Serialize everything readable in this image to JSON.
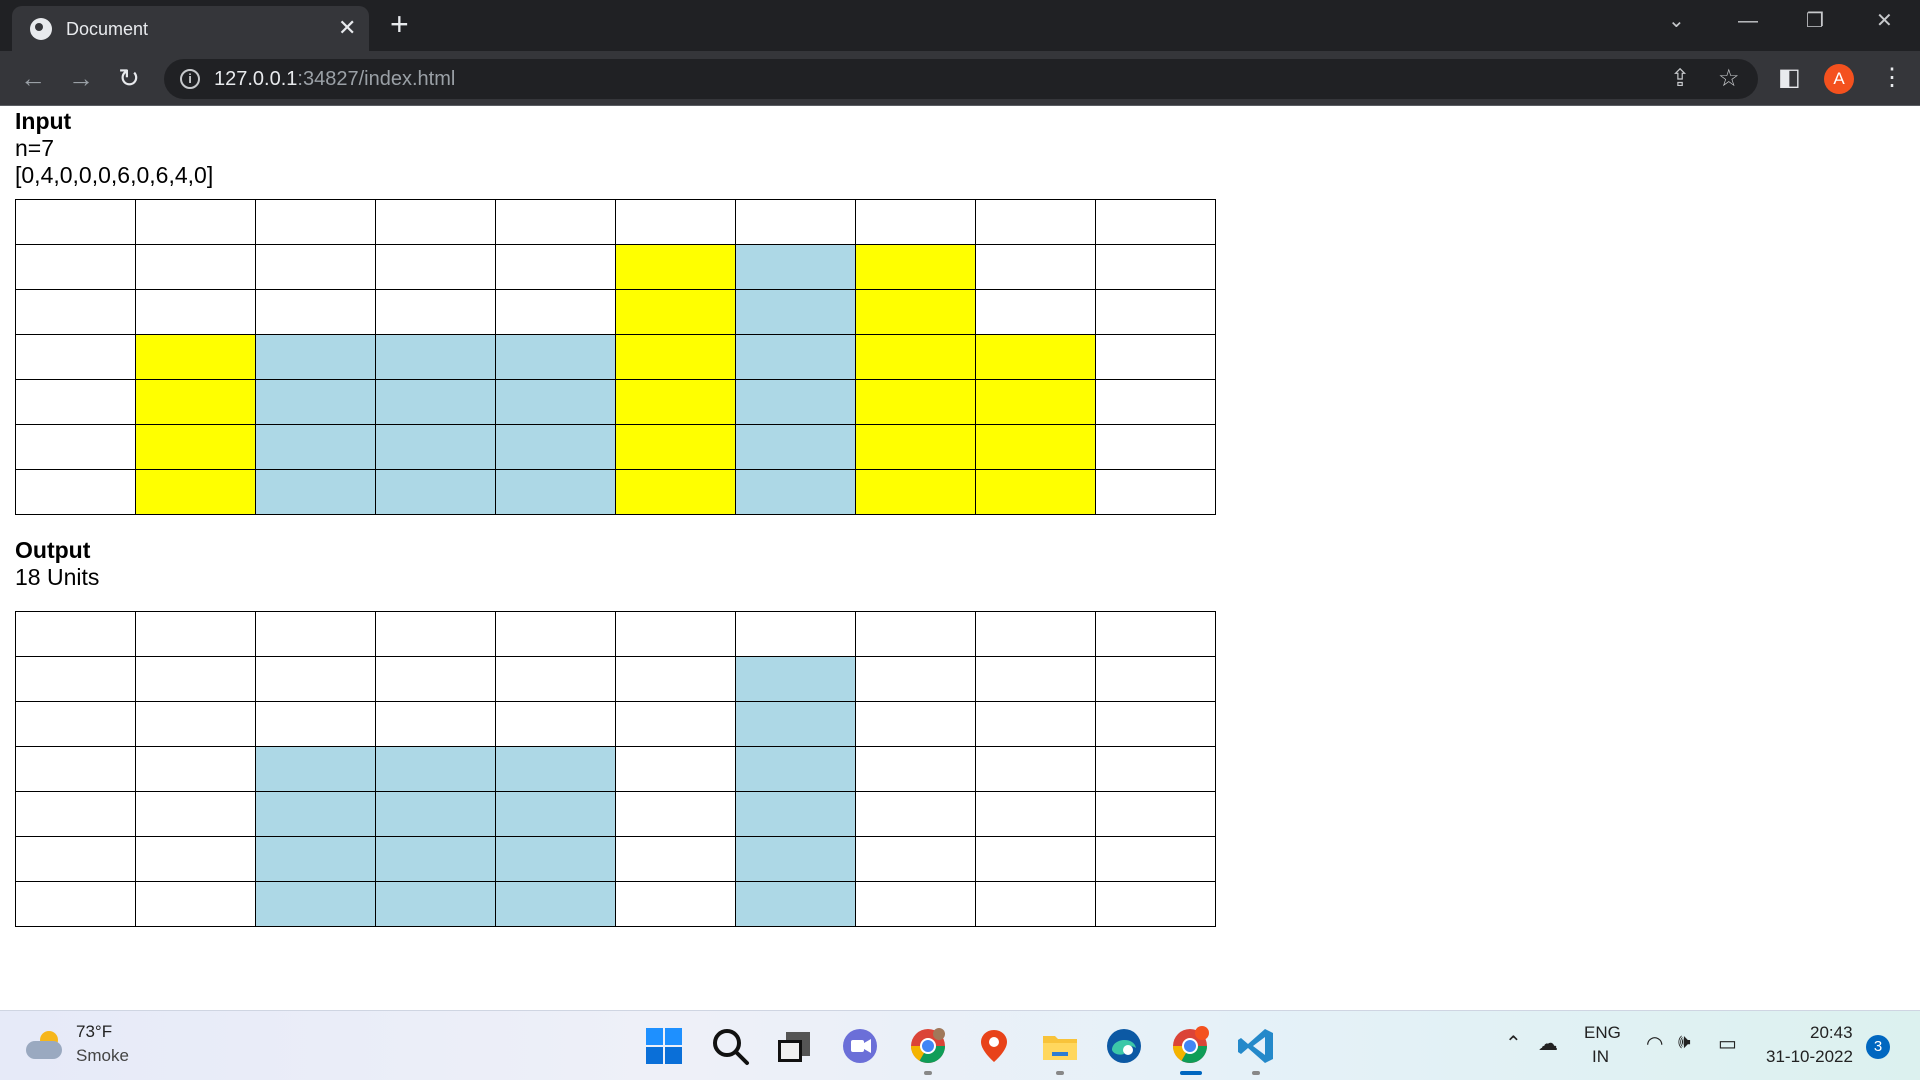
{
  "browser": {
    "tab_title": "Document",
    "tab_close": "✕",
    "new_tab": "+",
    "url_host": "127.0.0.1",
    "url_rest": ":34827/index.html",
    "avatar_letter": "A"
  },
  "page": {
    "input_heading": "Input",
    "n_text": "n=7",
    "array_text": "[0,4,0,0,0,6,0,6,4,0]",
    "output_heading": "Output",
    "output_value": "18 Units",
    "colors": {
      "bar": "#ffff00",
      "water": "#add8e6",
      "empty": "#ffffff",
      "border": "#000000"
    },
    "input_grid": [
      [
        "empty",
        "empty",
        "empty",
        "empty",
        "empty",
        "empty",
        "empty",
        "empty",
        "empty",
        "empty"
      ],
      [
        "empty",
        "empty",
        "empty",
        "empty",
        "empty",
        "bar",
        "water",
        "bar",
        "empty",
        "empty"
      ],
      [
        "empty",
        "empty",
        "empty",
        "empty",
        "empty",
        "bar",
        "water",
        "bar",
        "empty",
        "empty"
      ],
      [
        "empty",
        "bar",
        "water",
        "water",
        "water",
        "bar",
        "water",
        "bar",
        "bar",
        "empty"
      ],
      [
        "empty",
        "bar",
        "water",
        "water",
        "water",
        "bar",
        "water",
        "bar",
        "bar",
        "empty"
      ],
      [
        "empty",
        "bar",
        "water",
        "water",
        "water",
        "bar",
        "water",
        "bar",
        "bar",
        "empty"
      ],
      [
        "empty",
        "bar",
        "water",
        "water",
        "water",
        "bar",
        "water",
        "bar",
        "bar",
        "empty"
      ]
    ],
    "output_grid": [
      [
        "empty",
        "empty",
        "empty",
        "empty",
        "empty",
        "empty",
        "empty",
        "empty",
        "empty",
        "empty"
      ],
      [
        "empty",
        "empty",
        "empty",
        "empty",
        "empty",
        "empty",
        "water",
        "empty",
        "empty",
        "empty"
      ],
      [
        "empty",
        "empty",
        "empty",
        "empty",
        "empty",
        "empty",
        "water",
        "empty",
        "empty",
        "empty"
      ],
      [
        "empty",
        "empty",
        "water",
        "water",
        "water",
        "empty",
        "water",
        "empty",
        "empty",
        "empty"
      ],
      [
        "empty",
        "empty",
        "water",
        "water",
        "water",
        "empty",
        "water",
        "empty",
        "empty",
        "empty"
      ],
      [
        "empty",
        "empty",
        "water",
        "water",
        "water",
        "empty",
        "water",
        "empty",
        "empty",
        "empty"
      ],
      [
        "empty",
        "empty",
        "water",
        "water",
        "water",
        "empty",
        "water",
        "empty",
        "empty",
        "empty"
      ]
    ]
  },
  "taskbar": {
    "weather_temp": "73°F",
    "weather_desc": "Smoke",
    "lang_top": "ENG",
    "lang_bottom": "IN",
    "time": "20:43",
    "date": "31-10-2022",
    "notification_count": "3",
    "apps": [
      "windows-start-icon",
      "search-icon",
      "task-view-icon",
      "chat-icon",
      "chrome-profile-icon",
      "maps-icon",
      "file-explorer-icon",
      "edge-icon",
      "chrome-icon",
      "vscode-icon"
    ]
  }
}
